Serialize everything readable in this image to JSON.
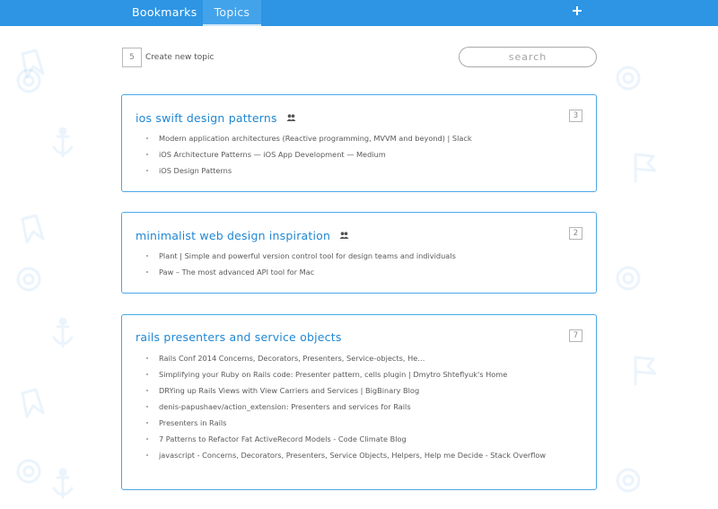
{
  "nav": {
    "tabs": [
      {
        "label": "Bookmarks",
        "active": false
      },
      {
        "label": "Topics",
        "active": true
      }
    ],
    "add_icon": "plus-icon",
    "accent_color": "#2d95e3"
  },
  "toolbar": {
    "topic_count": "5",
    "create_label": "Create new topic",
    "search_placeholder": "search"
  },
  "topics": [
    {
      "title": "ios swift design patterns",
      "shared_icon": "people-icon",
      "count": "3",
      "links": [
        "Modern application architectures (Reactive programming, MVVM and beyond) | Slack",
        "iOS Architecture Patterns — iOS App Development — Medium",
        "iOS Design Patterns"
      ]
    },
    {
      "title": "minimalist web design inspiration",
      "shared_icon": "people-icon",
      "count": "2",
      "links": [
        "Plant | Simple and powerful version control tool for design teams and individuals",
        "Paw – The most advanced API tool for Mac"
      ]
    },
    {
      "title": "rails presenters and service objects",
      "count": "7",
      "links": [
        "Rails Conf 2014 Concerns, Decorators, Presenters, Service-objects, He…",
        "Simplifying your Ruby on Rails code: Presenter pattern, cells plugin | Dmytro Shteflyuk's Home",
        "DRYing up Rails Views with View Carriers and Services | BigBinary Blog",
        "denis-papushaev/action_extension: Presenters and services for Rails",
        "Presenters in Rails",
        "7 Patterns to Refactor Fat ActiveRecord Models - Code Climate Blog",
        "javascript - Concerns, Decorators, Presenters, Service Objects, Helpers, Help me Decide - Stack Overflow"
      ]
    }
  ]
}
